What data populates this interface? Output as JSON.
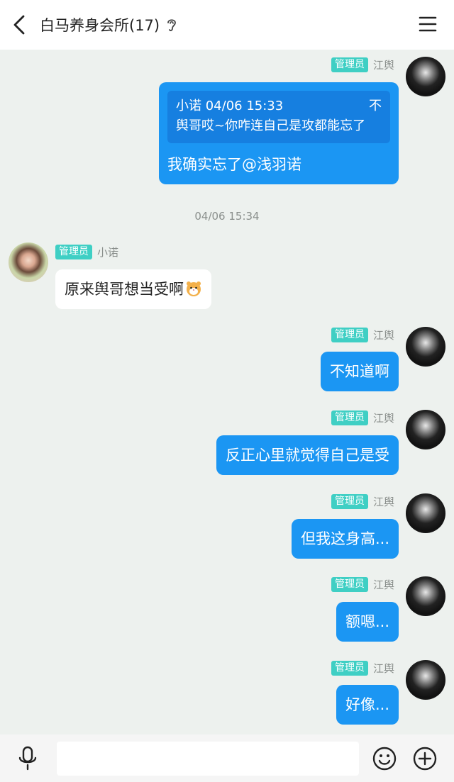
{
  "header": {
    "title": "白马养身会所(17)",
    "back_icon": "chevron-left-icon",
    "ear_icon": "ear-icon",
    "menu_icon": "hamburger-menu-icon"
  },
  "messages": [
    {
      "sender": "江舆",
      "role": "管理员",
      "side": "right",
      "quote": {
        "author_time": "小诺 04/06 15:33",
        "text": "舆哥哎~你咋连自己是攻都能忘了",
        "close": "不"
      },
      "text": "我确实忘了@浅羽诺"
    },
    {
      "timestamp": "04/06 15:34"
    },
    {
      "sender": "小诺",
      "role": "管理员",
      "side": "left",
      "text": "原来舆哥想当受啊"
    },
    {
      "sender": "江舆",
      "role": "管理员",
      "side": "right",
      "text": "不知道啊"
    },
    {
      "sender": "江舆",
      "role": "管理员",
      "side": "right",
      "text": "反正心里就觉得自己是受"
    },
    {
      "sender": "江舆",
      "role": "管理员",
      "side": "right",
      "text": "但我这身高..."
    },
    {
      "sender": "江舆",
      "role": "管理员",
      "side": "right",
      "text": "额嗯..."
    },
    {
      "sender": "江舆",
      "role": "管理员",
      "side": "right",
      "text": "好像..."
    }
  ],
  "input": {
    "placeholder": "",
    "mic_icon": "microphone-icon",
    "emoji_icon": "smiley-icon",
    "plus_icon": "plus-circle-icon"
  },
  "colors": {
    "accent": "#1b96f3",
    "badge": "#3fcfc4",
    "background": "#edf1ee"
  }
}
